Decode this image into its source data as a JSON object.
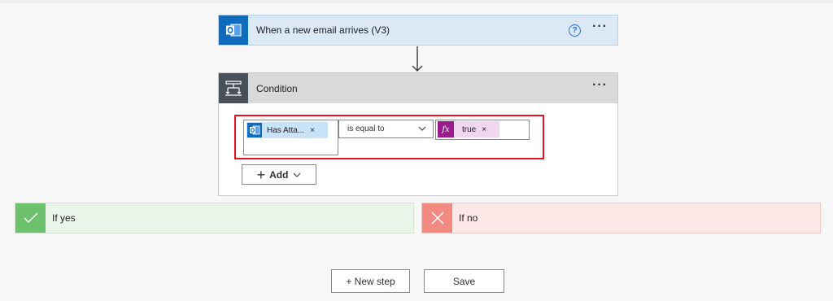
{
  "trigger": {
    "title": "When a new email arrives (V3)",
    "help_label": "?",
    "more_label": "···"
  },
  "condition": {
    "title": "Condition",
    "more_label": "···",
    "left_token": {
      "label": "Has Atta...",
      "remove": "×"
    },
    "operator": {
      "value": "is equal to"
    },
    "right_token": {
      "icon_label": "fx",
      "label": "true",
      "remove": "×"
    },
    "add_button": {
      "plus": "+",
      "label": "Add"
    }
  },
  "branches": {
    "yes": {
      "label": "If yes"
    },
    "no": {
      "label": "If no"
    }
  },
  "footer": {
    "new_step_label": "+ New step",
    "save_label": "Save"
  },
  "colors": {
    "outlook_blue": "#0f6cbd",
    "highlight_red": "#e81123",
    "yes_green": "#6cc16c",
    "no_red": "#f28a82",
    "fx_purple": "#9b1a8c"
  }
}
